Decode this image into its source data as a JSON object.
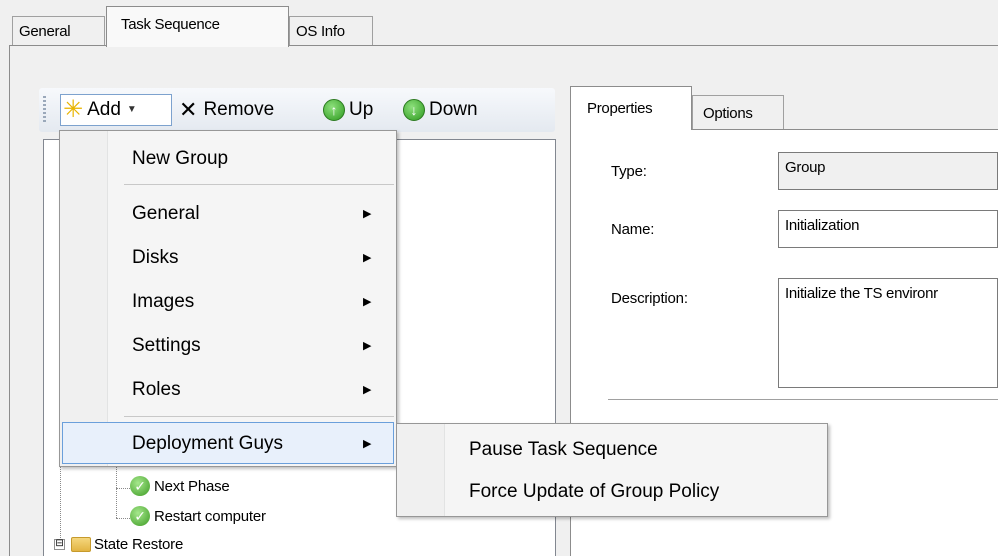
{
  "outer_tabs": [
    {
      "label": "General"
    },
    {
      "label": "Task Sequence",
      "selected": true
    },
    {
      "label": "OS Info"
    }
  ],
  "toolbar": {
    "add_label": "Add",
    "remove_label": "Remove",
    "up_label": "Up",
    "down_label": "Down"
  },
  "tree": {
    "items": [
      {
        "label": "Next Phase",
        "icon": "check-icon"
      },
      {
        "label": "Restart computer",
        "icon": "check-icon"
      },
      {
        "label": "State Restore",
        "icon": "folder-icon",
        "expander": "⊟"
      }
    ]
  },
  "add_menu": {
    "items": [
      {
        "label": "New Group",
        "has_submenu": false
      },
      {
        "label": "General",
        "has_submenu": true
      },
      {
        "label": "Disks",
        "has_submenu": true
      },
      {
        "label": "Images",
        "has_submenu": true
      },
      {
        "label": "Settings",
        "has_submenu": true
      },
      {
        "label": "Roles",
        "has_submenu": true
      },
      {
        "label": "Deployment Guys",
        "has_submenu": true,
        "highlighted": true
      }
    ],
    "submenu_items": [
      {
        "label": "Pause Task Sequence"
      },
      {
        "label": "Force Update of Group Policy"
      }
    ]
  },
  "properties": {
    "tabs": [
      {
        "label": "Properties",
        "selected": true
      },
      {
        "label": "Options"
      }
    ],
    "type_label": "Type:",
    "type_value": "Group",
    "name_label": "Name:",
    "name_value": "Initialization",
    "description_label": "Description:",
    "description_value": "Initialize the TS environr"
  },
  "colors": {
    "window_bg": "#f0f0f0",
    "menu_highlight_border": "#6a9fdb",
    "menu_highlight_bg": "#e8f0fb",
    "check_green": "#3c9a22"
  }
}
